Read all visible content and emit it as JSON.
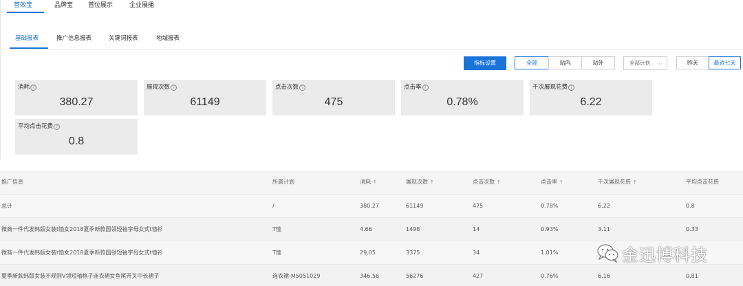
{
  "top_tabs": [
    "营效宝",
    "品牌宝",
    "首位展示",
    "企业展播"
  ],
  "report_tabs": [
    "基础报表",
    "推广信息报表",
    "关键词报表",
    "地域报表"
  ],
  "toolbar": {
    "indicator_settings": "指标设置",
    "scope": [
      "全部",
      "站内",
      "站外"
    ],
    "plan_select": "全部计划",
    "date_range": [
      "昨天",
      "最近七天"
    ]
  },
  "metrics": [
    {
      "label": "消耗",
      "value": "380.27"
    },
    {
      "label": "展现次数",
      "value": "61149"
    },
    {
      "label": "点击次数",
      "value": "475"
    },
    {
      "label": "点击率",
      "value": "0.78%"
    },
    {
      "label": "千次展现花费",
      "value": "6.22"
    },
    {
      "label": "平均点击花费",
      "value": "0.8"
    }
  ],
  "help_icon_glyph": "?",
  "sort_glyph": "↑",
  "table": {
    "headers": [
      "推广信息",
      "所属计划",
      "消耗",
      "展现次数",
      "点击次数",
      "点击率",
      "千次展现花费",
      "平均点击花费"
    ],
    "rows": [
      [
        "总计",
        "/",
        "380.27",
        "61149",
        "475",
        "0.78%",
        "6.22",
        "0.8"
      ],
      [
        "微商一件代发韩版女装t恤女2018夏季新款圆领短袖字母女式t恤衫",
        "T恤",
        "4.66",
        "1498",
        "14",
        "0.93%",
        "3.11",
        "0.33"
      ],
      [
        "微商一件代发韩版女装t恤女2018夏季新款圆领短袖字母女式t恤衫",
        "T恤",
        "29.05",
        "3375",
        "34",
        "1.01%",
        "",
        ""
      ],
      [
        "夏季新款韩版女装不规则V领短袖格子连衣裙女鱼尾开叉中长裙子",
        "连衣裙-M5051029",
        "346.56",
        "56276",
        "427",
        "0.76%",
        "6.16",
        "0.81"
      ]
    ]
  },
  "watermark": {
    "text": "金迅博科技",
    "icon": "wechat-icon"
  },
  "colors": {
    "accent": "#1a73d9",
    "card_bg": "#ebebeb"
  }
}
